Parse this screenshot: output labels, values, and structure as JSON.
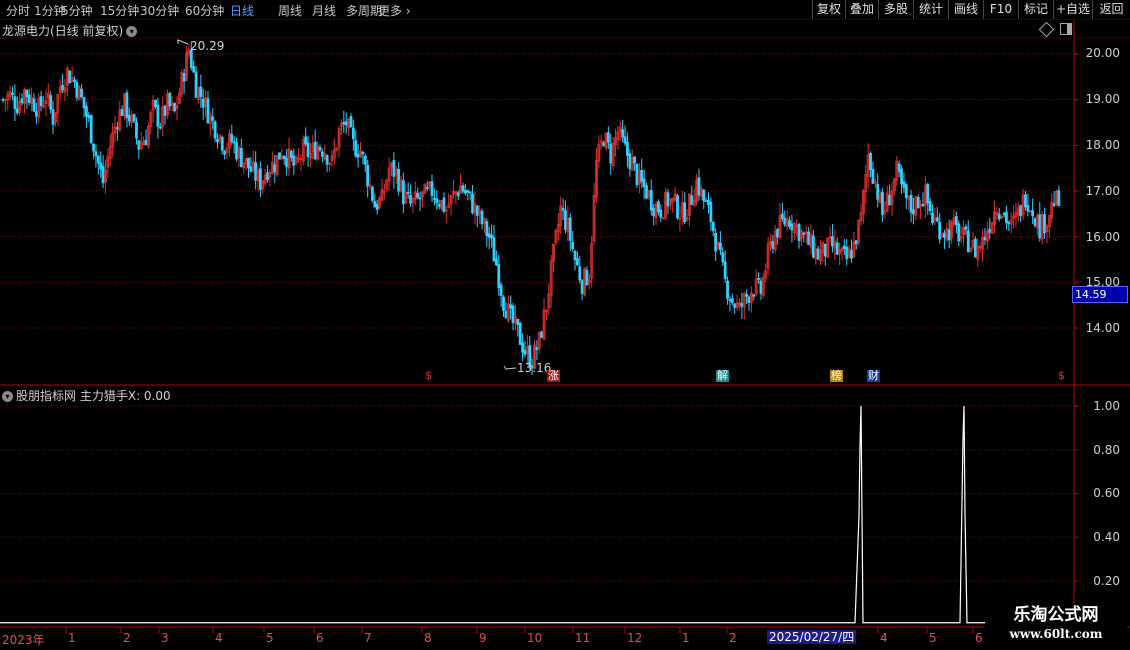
{
  "toolbar": {
    "periods": [
      "分时",
      "1分钟",
      "5分钟",
      "15分钟",
      "30分钟",
      "60分钟",
      "日线",
      "周线",
      "月线",
      "多周期",
      "更多"
    ],
    "active_period": "日线",
    "more_arrow": "›",
    "right_buttons": [
      "复权",
      "叠加",
      "多股",
      "统计",
      "画线",
      "F10",
      "标记",
      "+自选",
      "返回"
    ]
  },
  "main_chart": {
    "stock_name": "龙源电力",
    "mode": "(日线 前复权)",
    "dropdown_icon": "chevron-down-icon",
    "high_label": "20.29",
    "low_label": "13.16",
    "current_price": "14.59",
    "y_ticks": [
      "20.00",
      "19.00",
      "18.00",
      "17.00",
      "16.00",
      "15.00",
      "14.00"
    ],
    "events": [
      {
        "label": "$",
        "color": "#e03030",
        "bg": "transparent"
      },
      {
        "label": "涨",
        "color": "#ffffff",
        "bg": "#a01818"
      },
      {
        "label": "解",
        "color": "#ffffff",
        "bg": "#1a8a8a"
      },
      {
        "label": "榜",
        "color": "#ffffff",
        "bg": "#b8860b"
      },
      {
        "label": "财",
        "color": "#ffffff",
        "bg": "#1a3a9a"
      },
      {
        "label": "$",
        "color": "#e03030",
        "bg": "transparent"
      }
    ]
  },
  "indicator": {
    "source": "股朋指标网",
    "name": "主力猎手X: 0.00",
    "y_ticks": [
      "1.00",
      "0.80",
      "0.60",
      "0.40",
      "0.20"
    ],
    "line_color": "#ffffff"
  },
  "date_axis": {
    "year": "2023年",
    "months": [
      "1",
      "2",
      "3",
      "4",
      "5",
      "6",
      "7",
      "8",
      "9",
      "10",
      "11",
      "12",
      "1",
      "2",
      "4",
      "5",
      "6"
    ],
    "current_date": "2025/02/27/四"
  },
  "colors": {
    "up": "#e03030",
    "down": "#30d0ff",
    "grid": "#8a0000",
    "border": "#c00000"
  },
  "watermark": {
    "line1": "乐淘公式网",
    "line2": "www.60lt.com"
  },
  "chart_data": {
    "type": "candlestick",
    "y_range_main": [
      13.0,
      20.5
    ],
    "y_range_indicator": [
      0,
      1.05
    ],
    "close_path": [
      19.0,
      19.1,
      18.9,
      19.2,
      19.0,
      18.8,
      19.1,
      18.6,
      19.3,
      19.6,
      19.4,
      19.0,
      18.5,
      17.8,
      17.2,
      18.0,
      18.6,
      18.9,
      18.5,
      18.0,
      18.2,
      18.8,
      18.5,
      18.9,
      18.7,
      19.4,
      20.1,
      19.3,
      19.0,
      18.6,
      18.3,
      18.0,
      18.1,
      17.8,
      17.6,
      17.4,
      17.2,
      17.5,
      17.6,
      17.9,
      17.7,
      17.5,
      17.9,
      17.8,
      18.0,
      17.9,
      17.6,
      18.3,
      18.5,
      18.0,
      17.9,
      17.3,
      16.7,
      16.8,
      17.5,
      17.4,
      16.9,
      16.7,
      16.8,
      16.9,
      17.0,
      16.8,
      16.6,
      16.9,
      17.1,
      16.9,
      16.6,
      16.3,
      16.0,
      15.4,
      14.6,
      14.2,
      13.9,
      13.5,
      13.3,
      13.7,
      14.5,
      15.6,
      16.6,
      16.2,
      15.5,
      15.0,
      15.2,
      17.6,
      18.2,
      17.8,
      18.3,
      17.9,
      17.6,
      17.2,
      17.0,
      16.7,
      16.6,
      16.8,
      16.7,
      16.5,
      16.7,
      17.2,
      16.8,
      16.4,
      15.7,
      15.0,
      14.6,
      14.4,
      14.7,
      14.9,
      14.8,
      15.6,
      16.1,
      16.3,
      16.4,
      16.2,
      16.0,
      15.8,
      15.6,
      15.7,
      15.8,
      15.6,
      15.5,
      15.8,
      16.4,
      17.8,
      17.2,
      16.5,
      16.9,
      17.4,
      16.9,
      16.6,
      16.8,
      16.9,
      16.4,
      16.2,
      16.1,
      16.2,
      16.0,
      15.9,
      15.7,
      15.9,
      16.3,
      16.7,
      16.5,
      16.2,
      16.5,
      16.9,
      16.6,
      16.2,
      16.4,
      16.8,
      16.7
    ],
    "indicator_spikes": [
      {
        "date_position": "2025-02",
        "value": 1.0
      },
      {
        "date_position": "2025-05",
        "value": 1.0
      }
    ]
  }
}
